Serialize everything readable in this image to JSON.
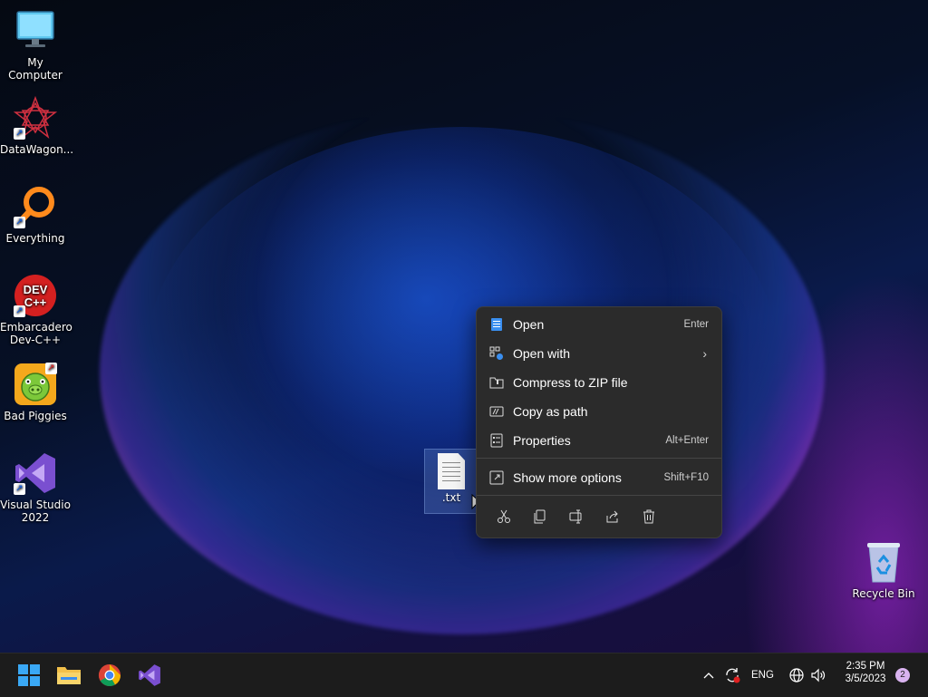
{
  "desktop": {
    "icons": [
      {
        "label": "My Computer"
      },
      {
        "label": "DataWagon..."
      },
      {
        "label": "Everything"
      },
      {
        "label": "Embarcadero Dev-C++",
        "line1": "Embarcadero",
        "line2": "Dev-C++",
        "logo_text": "DEV C++"
      },
      {
        "label": "Bad Piggies"
      },
      {
        "label": "Visual Studio 2022",
        "line1": "Visual Studio",
        "line2": "2022"
      }
    ],
    "recycle_bin": {
      "label": "Recycle Bin"
    },
    "selected_file": {
      "label": ".txt"
    }
  },
  "context_menu": {
    "items": [
      {
        "label": "Open",
        "shortcut": "Enter",
        "icon": "notepad-icon"
      },
      {
        "label": "Open with",
        "shortcut": "",
        "icon": "open-with-icon",
        "has_submenu": true
      },
      {
        "label": "Compress to ZIP file",
        "shortcut": "",
        "icon": "zip-folder-icon"
      },
      {
        "label": "Copy as path",
        "shortcut": "",
        "icon": "copy-path-icon"
      },
      {
        "label": "Properties",
        "shortcut": "Alt+Enter",
        "icon": "properties-icon"
      },
      {
        "label": "Show more options",
        "shortcut": "Shift+F10",
        "icon": "show-more-icon"
      }
    ],
    "actions": [
      "cut-icon",
      "copy-icon",
      "rename-icon",
      "share-icon",
      "delete-icon"
    ]
  },
  "taskbar": {
    "apps": [
      "start-icon",
      "file-explorer-icon",
      "chrome-icon",
      "visual-studio-icon"
    ],
    "tray": {
      "language": "ENG",
      "time": "2:35 PM",
      "date": "3/5/2023",
      "notification_count": "2"
    }
  },
  "colors": {
    "menu_bg": "#2b2b2b",
    "taskbar_bg": "#1c1c1c",
    "accent": "#3a8ff0",
    "badge": "#d9b3f0"
  }
}
